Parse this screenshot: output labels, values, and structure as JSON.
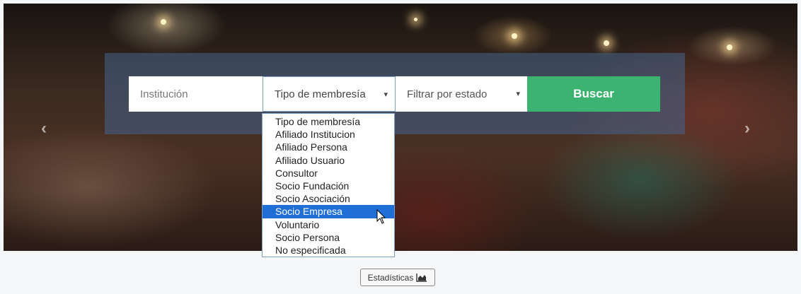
{
  "search": {
    "institucion_placeholder": "Institución",
    "tipo_selected": "Tipo de membresía",
    "estado_selected": "Filtrar por estado",
    "caret": "▾",
    "buscar_label": "Buscar"
  },
  "carousel": {
    "prev": "‹",
    "next": "›"
  },
  "dropdown": {
    "options": [
      "Tipo de membresía",
      "Afiliado Institucion",
      "Afiliado Persona",
      "Afiliado Usuario",
      "Consultor",
      "Socio Fundación",
      "Socio Asociación",
      "Socio Empresa",
      "Voluntario",
      "Socio Persona",
      "No especificada"
    ],
    "highlighted": "Socio Empresa"
  },
  "footer": {
    "stats_label": "Estadísticas",
    "stats_icon": "area-chart-icon"
  },
  "colors": {
    "accent_button": "#3cb371",
    "highlight": "#1f6fd6"
  }
}
